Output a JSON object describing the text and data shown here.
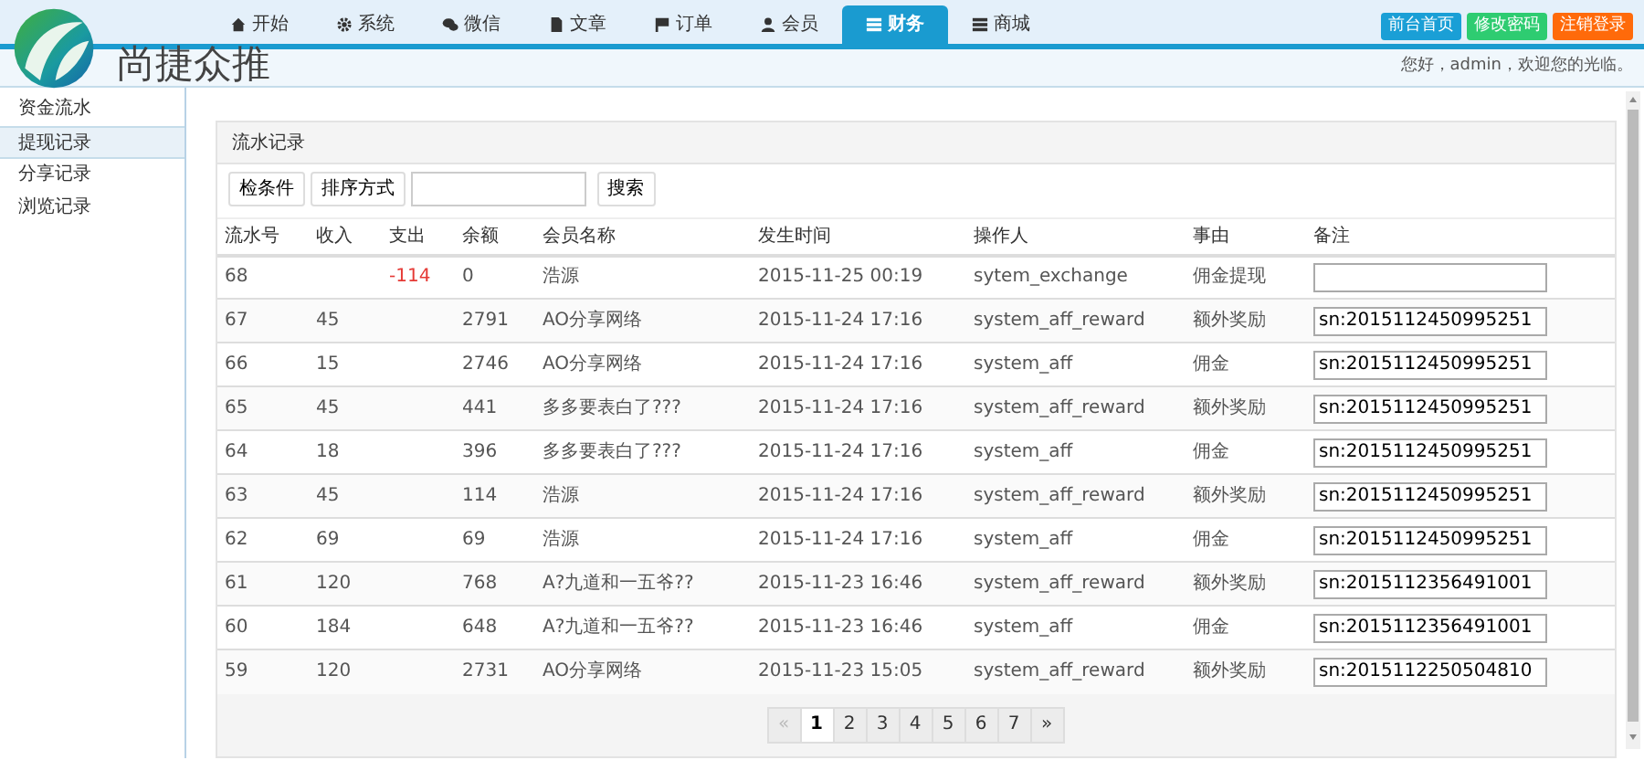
{
  "logo": {
    "text": "尚捷众推"
  },
  "nav_tabs": [
    {
      "label": "开始",
      "selected": false
    },
    {
      "label": "系统",
      "selected": false
    },
    {
      "label": "微信",
      "selected": false
    },
    {
      "label": "文章",
      "selected": false
    },
    {
      "label": "订单",
      "selected": false
    },
    {
      "label": "会员",
      "selected": false
    },
    {
      "label": "财务",
      "selected": true
    },
    {
      "label": "商城",
      "selected": false
    }
  ],
  "top_buttons": [
    {
      "label": "前台首页",
      "color": "#1a9fd6"
    },
    {
      "label": "修改密码",
      "color": "#2ecc71"
    },
    {
      "label": "注销登录",
      "color": "#ff6a0a"
    }
  ],
  "welcome": "您好，admin，欢迎您的光临。",
  "sidebar": {
    "items": [
      {
        "label": "资金流水",
        "selected": false
      },
      {
        "label": "提现记录",
        "selected": true
      },
      {
        "label": "分享记录",
        "selected": false
      },
      {
        "label": "浏览记录",
        "selected": false
      }
    ]
  },
  "panel": {
    "title": "流水记录",
    "toolbar": {
      "buttons": [
        "检条件",
        "排序方式"
      ],
      "search_button": "搜索"
    },
    "table": {
      "columns": [
        "流水号",
        "收入",
        "支出",
        "余额",
        "会员名称",
        "发生时间",
        "操作人",
        "事由",
        "备注"
      ],
      "rows": [
        [
          "68",
          "",
          "-114",
          "0",
          "浩源",
          "2015-11-25 00:19",
          "sytem_exchange",
          "佣金提现",
          ""
        ],
        [
          "67",
          "45",
          "",
          "2791",
          "AO分享网络",
          "2015-11-24 17:16",
          "system_aff_reward",
          "额外奖励",
          "sn:2015112450995251"
        ],
        [
          "66",
          "15",
          "",
          "2746",
          "AO分享网络",
          "2015-11-24 17:16",
          "system_aff",
          "佣金",
          "sn:2015112450995251"
        ],
        [
          "65",
          "45",
          "",
          "441",
          "多多要表白了???",
          "2015-11-24 17:16",
          "system_aff_reward",
          "额外奖励",
          "sn:2015112450995251"
        ],
        [
          "64",
          "18",
          "",
          "396",
          "多多要表白了???",
          "2015-11-24 17:16",
          "system_aff",
          "佣金",
          "sn:2015112450995251"
        ],
        [
          "63",
          "45",
          "",
          "114",
          "浩源",
          "2015-11-24 17:16",
          "system_aff_reward",
          "额外奖励",
          "sn:2015112450995251"
        ],
        [
          "62",
          "69",
          "",
          "69",
          "浩源",
          "2015-11-24 17:16",
          "system_aff",
          "佣金",
          "sn:2015112450995251"
        ],
        [
          "61",
          "120",
          "",
          "768",
          "A?九道和一五爷??",
          "2015-11-23 16:46",
          "system_aff_reward",
          "额外奖励",
          "sn:2015112356491001"
        ],
        [
          "60",
          "184",
          "",
          "648",
          "A?九道和一五爷??",
          "2015-11-23 16:46",
          "system_aff",
          "佣金",
          "sn:2015112356491001"
        ],
        [
          "59",
          "120",
          "",
          "2731",
          "AO分享网络",
          "2015-11-23 15:05",
          "system_aff_reward",
          "额外奖励",
          "sn:2015112250504810"
        ]
      ]
    },
    "pagination": [
      {
        "label": "«",
        "selected": false,
        "disabled": true
      },
      {
        "label": "1",
        "selected": true,
        "disabled": false
      },
      {
        "label": "2",
        "selected": false,
        "disabled": false
      },
      {
        "label": "3",
        "selected": false,
        "disabled": false
      },
      {
        "label": "4",
        "selected": false,
        "disabled": false
      },
      {
        "label": "5",
        "selected": false,
        "disabled": false
      },
      {
        "label": "6",
        "selected": false,
        "disabled": false
      },
      {
        "label": "7",
        "selected": false,
        "disabled": false
      },
      {
        "label": "»",
        "selected": false,
        "disabled": false
      }
    ]
  }
}
